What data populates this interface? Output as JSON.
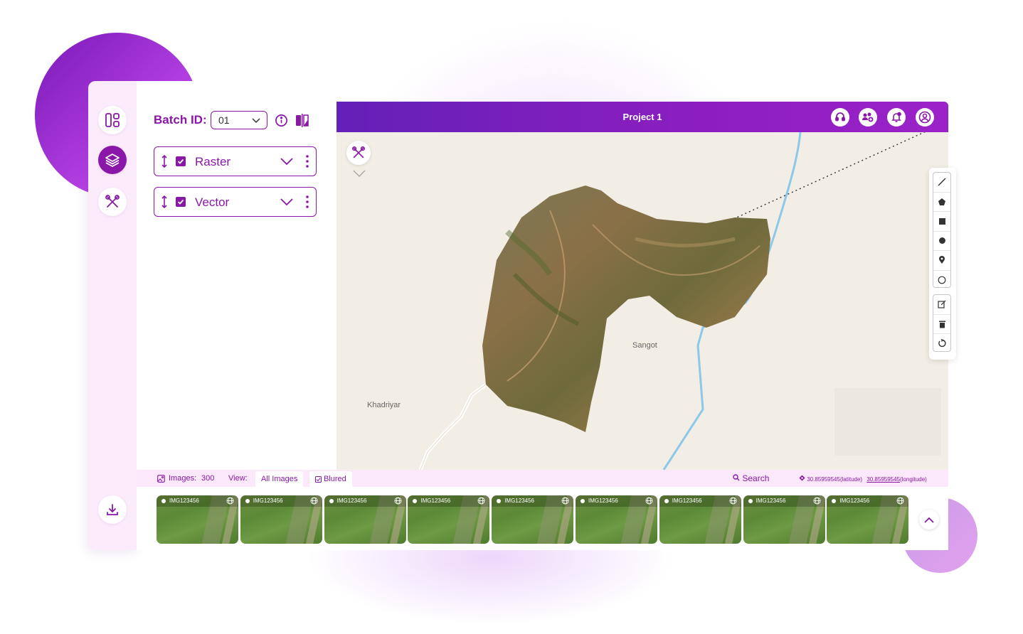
{
  "project": {
    "title": "Project 1"
  },
  "panel": {
    "batch_label": "Batch ID:",
    "batch_value": "01",
    "layers": [
      {
        "label": "Raster",
        "checked": true
      },
      {
        "label": "Vector",
        "checked": true
      }
    ]
  },
  "map": {
    "places": [
      "Sangot",
      "Khadriyar"
    ]
  },
  "bottom": {
    "images_label": "Images:",
    "images_count": "300",
    "view_label": "View:",
    "tabs": [
      "All Images",
      "Blured"
    ],
    "search_label": "Search",
    "latitude": "30.85959545",
    "latitude_suffix": "(latitude)",
    "longitude": "30.85959545",
    "longitude_suffix": "(longitude)",
    "thumbnails": [
      "IMG123456",
      "IMG123456",
      "IMG123456",
      "IMG123456",
      "IMG123456",
      "IMG123456",
      "IMG123456",
      "IMG123456",
      "IMG123456"
    ]
  },
  "icons": {
    "rail": [
      "dashboard-icon",
      "layers-icon",
      "tools-icon",
      "download-icon"
    ],
    "topbar": [
      "headset-icon",
      "users-add-icon",
      "notification-icon",
      "user-icon"
    ],
    "draw_tools": [
      "polyline-icon",
      "polygon-icon",
      "rectangle-icon",
      "circle-icon",
      "marker-icon",
      "circle-marker-icon"
    ],
    "edit_tools": [
      "edit-icon",
      "delete-icon",
      "rotate-icon"
    ]
  },
  "colors": {
    "accent": "#8a17a8",
    "header_start": "#6320b8",
    "header_end": "#9b22c8",
    "panel_bg": "#fcecfb"
  }
}
